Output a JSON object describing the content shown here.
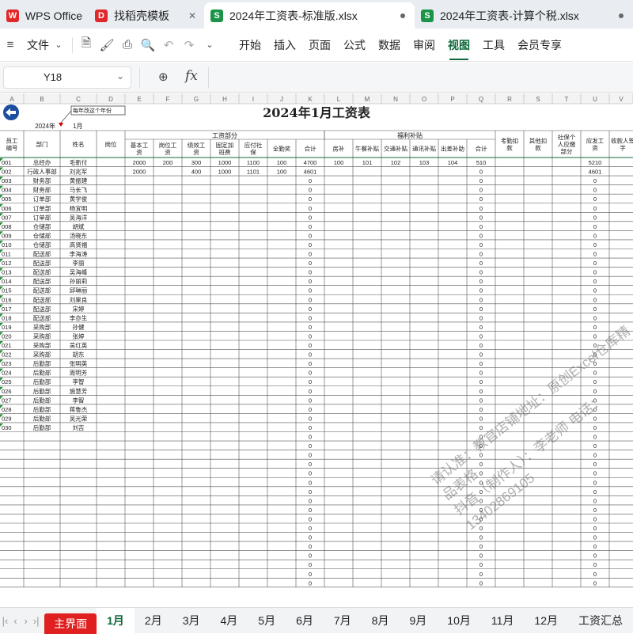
{
  "file_tabs": [
    {
      "label": "WPS Office",
      "icon": "wps-logo-icon",
      "color": "#e0282a"
    },
    {
      "label": "找稻壳模板",
      "icon": "docer-icon",
      "color": "#e0282a"
    },
    {
      "label": "2024年工资表-标准版.xlsx",
      "icon": "spreadsheet-icon",
      "color": "#1b9448"
    },
    {
      "label": "2024年工资表-计算个税.xlsx",
      "icon": "spreadsheet-icon",
      "color": "#1b9448"
    }
  ],
  "menu": {
    "file": "文件",
    "items": [
      "开始",
      "插入",
      "页面",
      "公式",
      "数据",
      "审阅",
      "视图",
      "工具",
      "会员专享"
    ],
    "active": "视图"
  },
  "formula": {
    "cell": "Y18",
    "value": ""
  },
  "columns": [
    "A",
    "B",
    "C",
    "D",
    "E",
    "F",
    "G",
    "H",
    "I",
    "J",
    "K",
    "L",
    "M",
    "N",
    "O",
    "P",
    "Q",
    "R",
    "S",
    "T",
    "U",
    "V"
  ],
  "sheet": {
    "title": "2024年1月工资表",
    "note": "每年改这个年份",
    "year": "2024年",
    "month": "1月",
    "headers": {
      "id": "员工编号",
      "dept": "部门",
      "name": "姓名",
      "post": "岗位",
      "salary_group": "工资部分",
      "salary": [
        "基本工资",
        "岗位工资",
        "绩效工资",
        "固定加班费",
        "应付社保",
        "全勤奖",
        "合计"
      ],
      "welfare_group": "福利补贴",
      "welfare": [
        "房补",
        "午餐补贴",
        "交通补贴",
        "通讯补贴",
        "出差补助",
        "合计"
      ],
      "attendance": "考勤扣款",
      "other": "其他扣款",
      "social": "社保个人应缴部分",
      "payable": "应发工资",
      "sign": "收款人签字"
    },
    "rows": [
      {
        "id": "001",
        "dept": "总经办",
        "name": "毛新付",
        "s": [
          "2000",
          "200",
          "300",
          "1000",
          "1100",
          "100",
          "4700"
        ],
        "w": [
          "100",
          "101",
          "102",
          "103",
          "104",
          "510"
        ],
        "pay": "5210"
      },
      {
        "id": "002",
        "dept": "行政人事部",
        "name": "刘兆军",
        "s": [
          "2000",
          "",
          "400",
          "1000",
          "1101",
          "100",
          "4601"
        ],
        "w": [
          "",
          "",
          "",
          "",
          "",
          "0"
        ],
        "pay": "4601"
      },
      {
        "id": "003",
        "dept": "财务部",
        "name": "黄振建",
        "s": [
          "",
          "",
          "",
          "",
          "",
          "",
          "0"
        ],
        "w": [
          "",
          "",
          "",
          "",
          "",
          "0"
        ],
        "pay": "0"
      },
      {
        "id": "004",
        "dept": "财务部",
        "name": "马长飞",
        "s": [
          "",
          "",
          "",
          "",
          "",
          "",
          "0"
        ],
        "w": [
          "",
          "",
          "",
          "",
          "",
          "0"
        ],
        "pay": "0"
      },
      {
        "id": "005",
        "dept": "订单部",
        "name": "黄学俊",
        "s": [
          "",
          "",
          "",
          "",
          "",
          "",
          "0"
        ],
        "w": [
          "",
          "",
          "",
          "",
          "",
          "0"
        ],
        "pay": "0"
      },
      {
        "id": "006",
        "dept": "订单部",
        "name": "杨宜明",
        "s": [
          "",
          "",
          "",
          "",
          "",
          "",
          "0"
        ],
        "w": [
          "",
          "",
          "",
          "",
          "",
          "0"
        ],
        "pay": "0"
      },
      {
        "id": "007",
        "dept": "订单部",
        "name": "吴海洋",
        "s": [
          "",
          "",
          "",
          "",
          "",
          "",
          "0"
        ],
        "w": [
          "",
          "",
          "",
          "",
          "",
          "0"
        ],
        "pay": "0"
      },
      {
        "id": "008",
        "dept": "仓储部",
        "name": "胡斌",
        "s": [
          "",
          "",
          "",
          "",
          "",
          "",
          "0"
        ],
        "w": [
          "",
          "",
          "",
          "",
          "",
          "0"
        ],
        "pay": "0"
      },
      {
        "id": "009",
        "dept": "仓储部",
        "name": "汤晓东",
        "s": [
          "",
          "",
          "",
          "",
          "",
          "",
          "0"
        ],
        "w": [
          "",
          "",
          "",
          "",
          "",
          "0"
        ],
        "pay": "0"
      },
      {
        "id": "010",
        "dept": "仓储部",
        "name": "高贤福",
        "s": [
          "",
          "",
          "",
          "",
          "",
          "",
          "0"
        ],
        "w": [
          "",
          "",
          "",
          "",
          "",
          "0"
        ],
        "pay": "0"
      },
      {
        "id": "011",
        "dept": "配送部",
        "name": "李海涛",
        "s": [
          "",
          "",
          "",
          "",
          "",
          "",
          "0"
        ],
        "w": [
          "",
          "",
          "",
          "",
          "",
          "0"
        ],
        "pay": "0"
      },
      {
        "id": "012",
        "dept": "配送部",
        "name": "李丽",
        "s": [
          "",
          "",
          "",
          "",
          "",
          "",
          "0"
        ],
        "w": [
          "",
          "",
          "",
          "",
          "",
          "0"
        ],
        "pay": "0"
      },
      {
        "id": "013",
        "dept": "配送部",
        "name": "吴海峰",
        "s": [
          "",
          "",
          "",
          "",
          "",
          "",
          "0"
        ],
        "w": [
          "",
          "",
          "",
          "",
          "",
          "0"
        ],
        "pay": "0"
      },
      {
        "id": "014",
        "dept": "配送部",
        "name": "孙丽莉",
        "s": [
          "",
          "",
          "",
          "",
          "",
          "",
          "0"
        ],
        "w": [
          "",
          "",
          "",
          "",
          "",
          "0"
        ],
        "pay": "0"
      },
      {
        "id": "015",
        "dept": "配送部",
        "name": "邱琳丽",
        "s": [
          "",
          "",
          "",
          "",
          "",
          "",
          "0"
        ],
        "w": [
          "",
          "",
          "",
          "",
          "",
          "0"
        ],
        "pay": "0"
      },
      {
        "id": "016",
        "dept": "配送部",
        "name": "刘果良",
        "s": [
          "",
          "",
          "",
          "",
          "",
          "",
          "0"
        ],
        "w": [
          "",
          "",
          "",
          "",
          "",
          "0"
        ],
        "pay": "0"
      },
      {
        "id": "017",
        "dept": "配送部",
        "name": "宋婷",
        "s": [
          "",
          "",
          "",
          "",
          "",
          "",
          "0"
        ],
        "w": [
          "",
          "",
          "",
          "",
          "",
          "0"
        ],
        "pay": "0"
      },
      {
        "id": "018",
        "dept": "配送部",
        "name": "李亦生",
        "s": [
          "",
          "",
          "",
          "",
          "",
          "",
          "0"
        ],
        "w": [
          "",
          "",
          "",
          "",
          "",
          "0"
        ],
        "pay": "0"
      },
      {
        "id": "019",
        "dept": "采购部",
        "name": "孙健",
        "s": [
          "",
          "",
          "",
          "",
          "",
          "",
          "0"
        ],
        "w": [
          "",
          "",
          "",
          "",
          "",
          "0"
        ],
        "pay": "0"
      },
      {
        "id": "020",
        "dept": "采购部",
        "name": "张婷",
        "s": [
          "",
          "",
          "",
          "",
          "",
          "",
          "0"
        ],
        "w": [
          "",
          "",
          "",
          "",
          "",
          "0"
        ],
        "pay": "0"
      },
      {
        "id": "021",
        "dept": "采购部",
        "name": "吴红英",
        "s": [
          "",
          "",
          "",
          "",
          "",
          "",
          "0"
        ],
        "w": [
          "",
          "",
          "",
          "",
          "",
          "0"
        ],
        "pay": "0"
      },
      {
        "id": "022",
        "dept": "采购部",
        "name": "胡东",
        "s": [
          "",
          "",
          "",
          "",
          "",
          "",
          "0"
        ],
        "w": [
          "",
          "",
          "",
          "",
          "",
          "0"
        ],
        "pay": "0"
      },
      {
        "id": "023",
        "dept": "后勤部",
        "name": "张明英",
        "s": [
          "",
          "",
          "",
          "",
          "",
          "",
          "0"
        ],
        "w": [
          "",
          "",
          "",
          "",
          "",
          "0"
        ],
        "pay": "0"
      },
      {
        "id": "024",
        "dept": "后勤部",
        "name": "周明芳",
        "s": [
          "",
          "",
          "",
          "",
          "",
          "",
          "0"
        ],
        "w": [
          "",
          "",
          "",
          "",
          "",
          "0"
        ],
        "pay": "0"
      },
      {
        "id": "025",
        "dept": "后勤部",
        "name": "李智",
        "s": [
          "",
          "",
          "",
          "",
          "",
          "",
          "0"
        ],
        "w": [
          "",
          "",
          "",
          "",
          "",
          "0"
        ],
        "pay": "0"
      },
      {
        "id": "026",
        "dept": "后勤部",
        "name": "施慧芳",
        "s": [
          "",
          "",
          "",
          "",
          "",
          "",
          "0"
        ],
        "w": [
          "",
          "",
          "",
          "",
          "",
          "0"
        ],
        "pay": "0"
      },
      {
        "id": "027",
        "dept": "后勤部",
        "name": "李智",
        "s": [
          "",
          "",
          "",
          "",
          "",
          "",
          "0"
        ],
        "w": [
          "",
          "",
          "",
          "",
          "",
          "0"
        ],
        "pay": "0"
      },
      {
        "id": "028",
        "dept": "后勤部",
        "name": "蒋鲁杰",
        "s": [
          "",
          "",
          "",
          "",
          "",
          "",
          "0"
        ],
        "w": [
          "",
          "",
          "",
          "",
          "",
          "0"
        ],
        "pay": "0"
      },
      {
        "id": "029",
        "dept": "后勤部",
        "name": "吴光荣",
        "s": [
          "",
          "",
          "",
          "",
          "",
          "",
          "0"
        ],
        "w": [
          "",
          "",
          "",
          "",
          "",
          "0"
        ],
        "pay": "0"
      },
      {
        "id": "030",
        "dept": "后勤部",
        "name": "刘吉",
        "s": [
          "",
          "",
          "",
          "",
          "",
          "",
          "0"
        ],
        "w": [
          "",
          "",
          "",
          "",
          "",
          "0"
        ],
        "pay": "0"
      }
    ],
    "empty_row": {
      "id": "",
      "dept": "",
      "name": "",
      "s": [
        "",
        "",
        "",
        "",
        "",
        "",
        "0"
      ],
      "w": [
        "",
        "",
        "",
        "",
        "",
        "0"
      ],
      "pay": "0"
    },
    "empty_row_count": 17
  },
  "sheet_tabs": [
    "主界面",
    "1月",
    "2月",
    "3月",
    "4月",
    "5月",
    "6月",
    "7月",
    "8月",
    "9月",
    "10月",
    "11月",
    "12月",
    "工资汇总"
  ],
  "active_sheet": "1月",
  "watermark": [
    "请认准：教官店铺地址：原创Excel仓库精品表格",
    "抖音（制作人）：李老师 电话：13402869105"
  ],
  "colors": {
    "accent": "#10683b",
    "grid": "#d8d8d8",
    "header_bg": "#f3f3f3",
    "red_tab": "#e02020",
    "back_button": "#1c4e9e"
  }
}
